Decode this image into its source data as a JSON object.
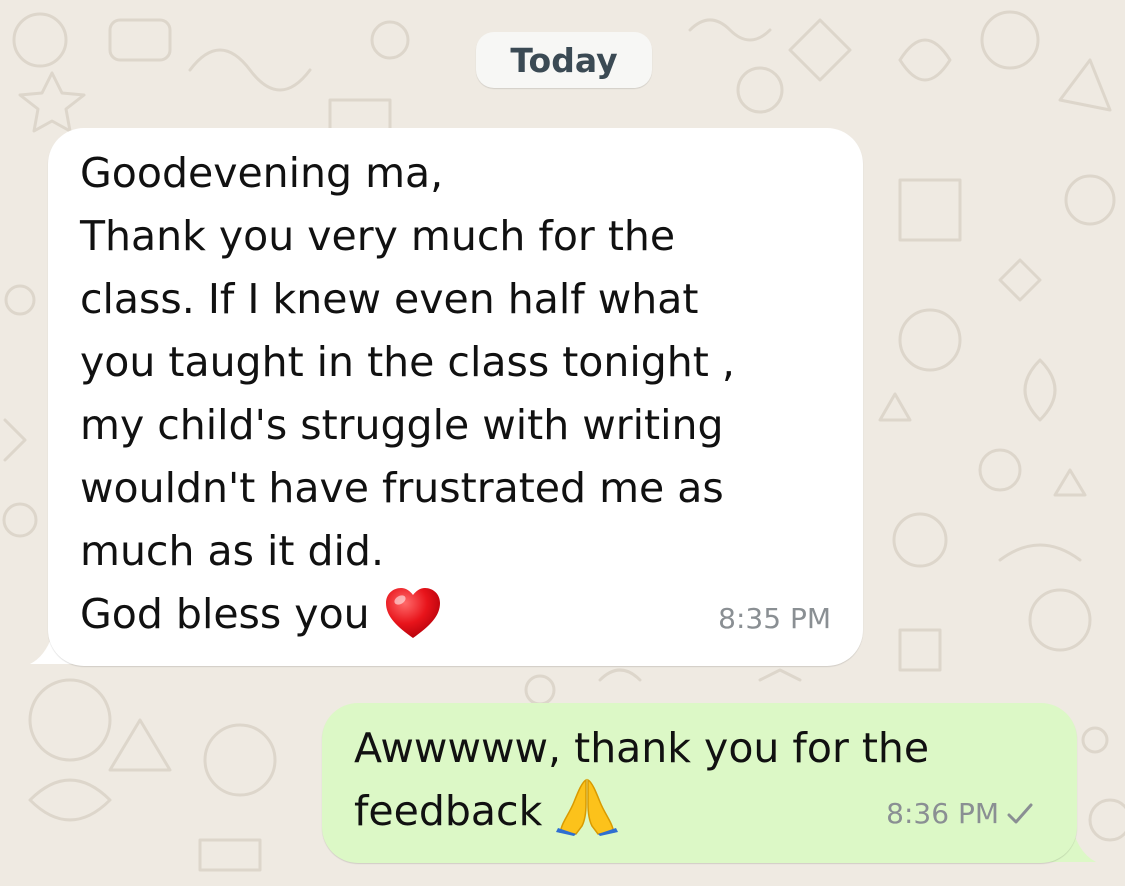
{
  "conversation": {
    "date_label": "Today",
    "messages": [
      {
        "direction": "incoming",
        "lines": [
          "Goodevening ma,",
          "Thank you very much for the",
          "class. If I knew even half what",
          "you taught in the class tonight ,",
          "my child's struggle with writing",
          "wouldn't have frustrated me as",
          "much as it did.",
          "God bless you"
        ],
        "trailing_emoji": "red-heart-icon",
        "time": "8:35 PM"
      },
      {
        "direction": "outgoing",
        "lines": [
          "Awwwww, thank you for the",
          "feedback"
        ],
        "trailing_emoji": "folded-hands-icon",
        "time": "8:36 PM",
        "status_icon": "single-check-icon"
      }
    ]
  },
  "colors": {
    "wallpaper": "#efeae2",
    "incoming_bubble": "#ffffff",
    "outgoing_bubble": "#dcf8c6",
    "timestamp": "#8a8f93"
  }
}
